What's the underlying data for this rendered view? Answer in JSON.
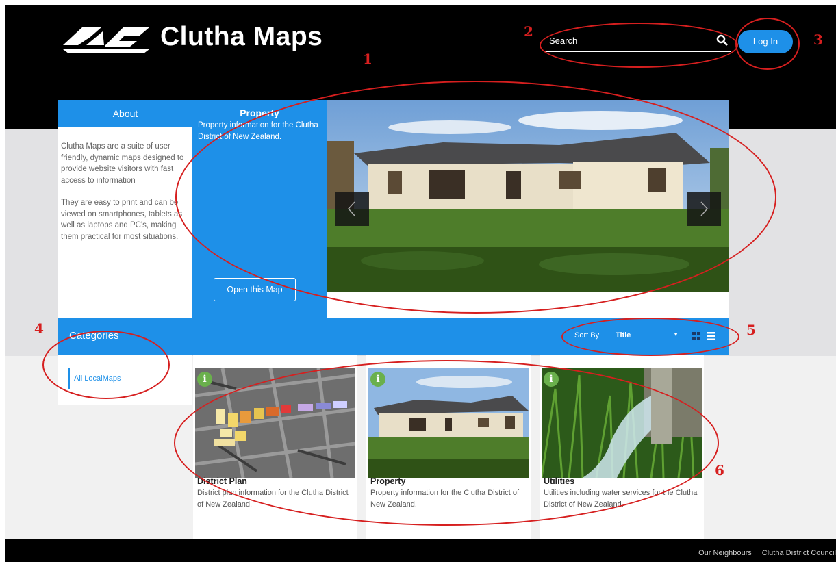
{
  "header": {
    "logo_text": "Clutha Maps",
    "search_placeholder": "Search",
    "login_label": "Log In"
  },
  "about": {
    "title": "About",
    "paragraphs": [
      "Clutha Maps are a suite of user friendly, dynamic maps designed to provide website visitors with fast access to information",
      "They are easy to print and can be viewed on smartphones, tablets as well as laptops and PC's, making them practical for most situations."
    ]
  },
  "featured": {
    "title": "Property",
    "description": "Property information for the Clutha District of New Zealand.",
    "open_label": "Open this Map"
  },
  "categories": {
    "title": "Categories",
    "items": [
      "All LocalMaps"
    ]
  },
  "sort": {
    "label": "Sort By",
    "value": "Title"
  },
  "cards": [
    {
      "title": "District Plan",
      "description": "District plan information for the Clutha District of New Zealand."
    },
    {
      "title": "Property",
      "description": "Property information for the Clutha District of New Zealand."
    },
    {
      "title": "Utilities",
      "description": "Utilities including water services for the Clutha District of New Zealand."
    }
  ],
  "footer": {
    "links": [
      "Our Neighbours",
      "Clutha District Council"
    ]
  },
  "annotations": [
    "1",
    "2",
    "3",
    "4",
    "5",
    "6"
  ],
  "colors": {
    "accent": "#1e90e8",
    "header_bg": "#000000",
    "annotation": "#d61f1f",
    "info_badge": "#6ab04c"
  }
}
